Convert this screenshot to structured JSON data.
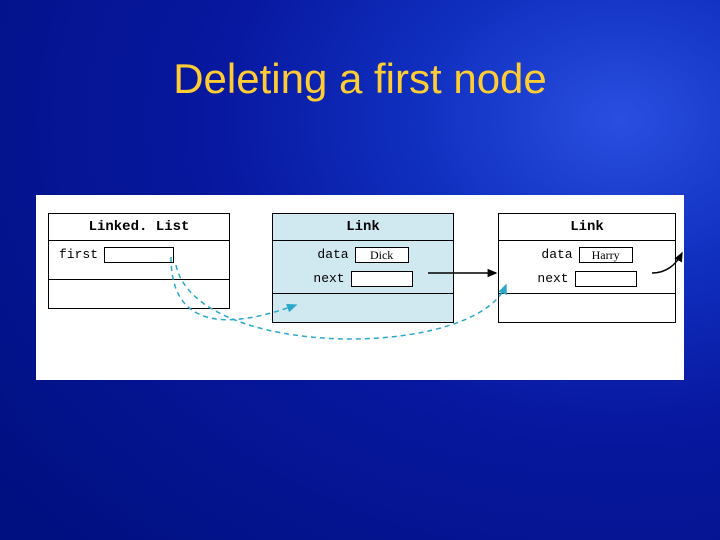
{
  "title": "Deleting a first node",
  "linkedlist": {
    "header": "Linked. List",
    "field1": "first"
  },
  "node1": {
    "header": "Link",
    "dataLabel": "data",
    "dataValue": "Dick",
    "nextLabel": "next"
  },
  "node2": {
    "header": "Link",
    "dataLabel": "data",
    "dataValue": "Harry",
    "nextLabel": "next"
  }
}
